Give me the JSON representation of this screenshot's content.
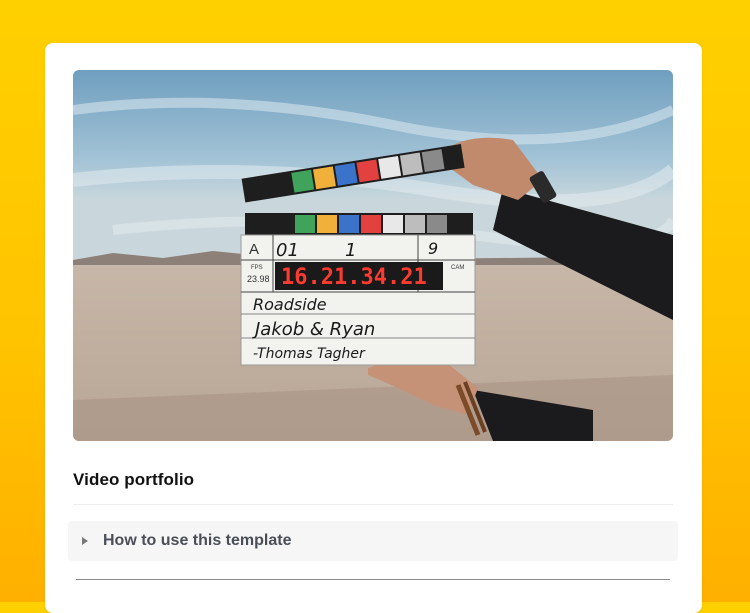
{
  "page": {
    "title": "Video portfolio",
    "toggle_label": "How to use this template"
  },
  "cover": {
    "slate": {
      "scene": "A",
      "roll": "01",
      "take": "1",
      "shot": "9",
      "fps_label": "FPS",
      "fps_value": "23.98",
      "cam_label": "CAM",
      "timecode": "16.21.34.21",
      "line1": "Roadside",
      "line2": "Jakob & Ryan",
      "line3": "-Thomas Tagher"
    }
  },
  "colors": {
    "background_top": "#ffd000",
    "background_bottom": "#ffb000",
    "card": "#ffffff",
    "toggle_bg": "#f6f6f7",
    "title_text": "#111111",
    "toggle_text": "#4a4f57"
  },
  "icons": {
    "toggle": "triangle-right-icon"
  }
}
